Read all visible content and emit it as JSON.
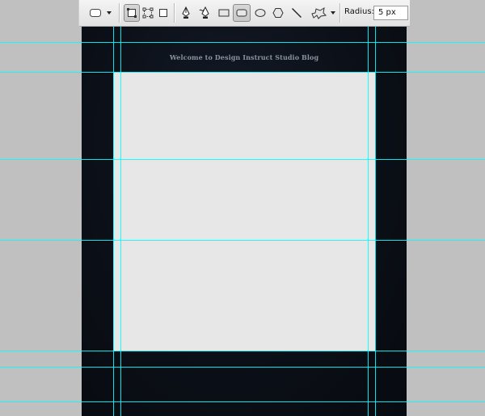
{
  "options_bar": {
    "radius_label": "Radius:",
    "radius_value": "5 px",
    "tools": [
      {
        "name": "preset-shape-icon",
        "pressed": false
      },
      {
        "name": "shape-layers-icon",
        "pressed": true
      },
      {
        "name": "paths-icon",
        "pressed": false
      },
      {
        "name": "fill-pixels-icon",
        "pressed": false
      },
      {
        "name": "pen-icon",
        "pressed": false
      },
      {
        "name": "freeform-pen-icon",
        "pressed": false
      },
      {
        "name": "rectangle-icon",
        "pressed": false
      },
      {
        "name": "rounded-rectangle-icon",
        "pressed": true
      },
      {
        "name": "ellipse-icon",
        "pressed": false
      },
      {
        "name": "polygon-icon",
        "pressed": false
      },
      {
        "name": "line-icon",
        "pressed": false
      },
      {
        "name": "custom-shape-icon",
        "pressed": false
      }
    ]
  },
  "canvas": {
    "header_text": "Welcome to Design Instruct Studio Blog",
    "colors": {
      "background": "#0b0f17",
      "content_panel": "#e7e7e7",
      "guides": "#00ffff",
      "workspace": "#c0c0c0"
    }
  }
}
